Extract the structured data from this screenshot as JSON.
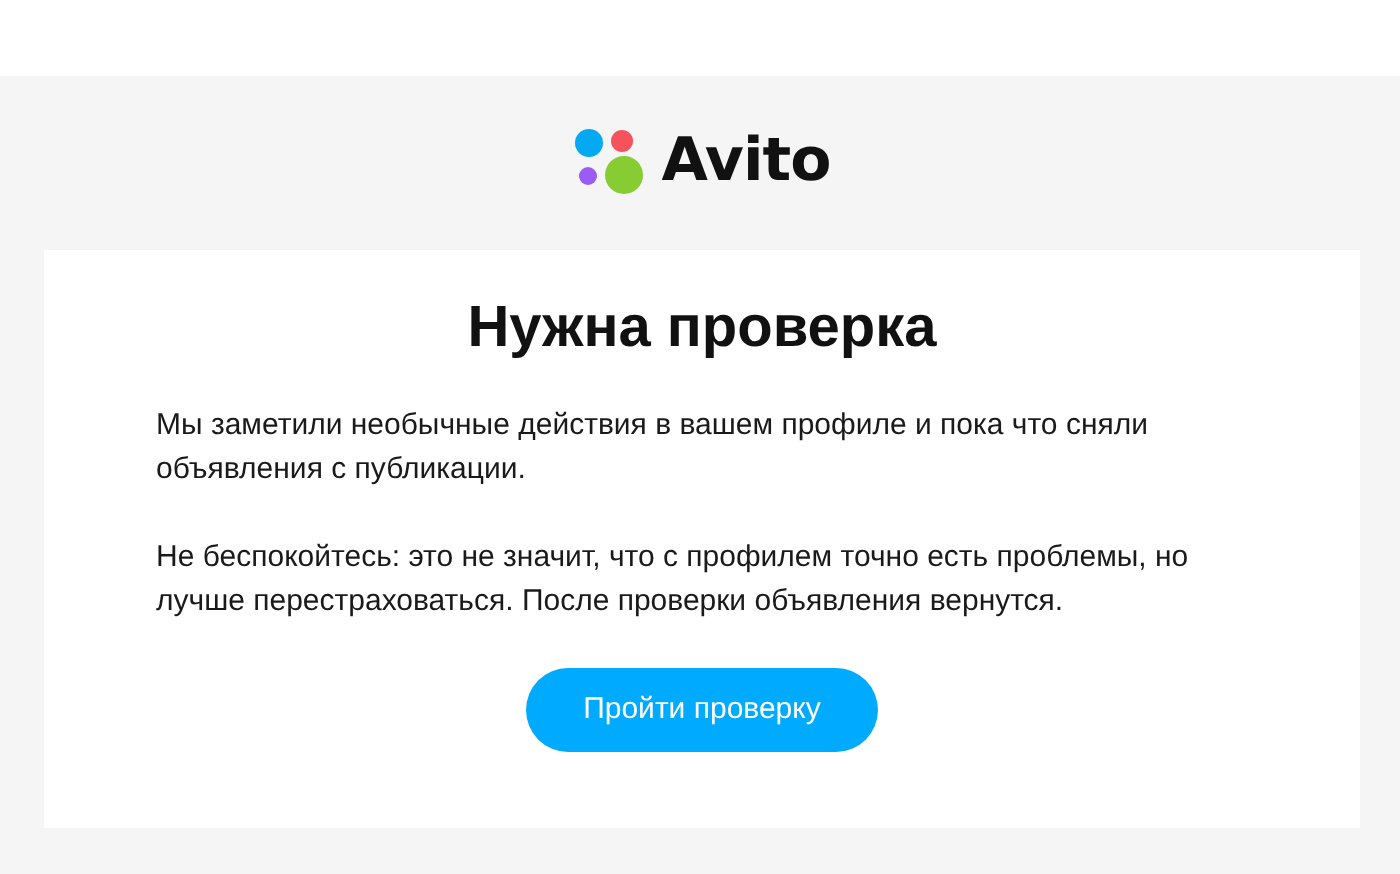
{
  "logo": {
    "text": "Avito"
  },
  "card": {
    "title": "Нужна проверка",
    "paragraphs": [
      "Мы заметили необычные действия в вашем профиле и пока что сняли объявления с публикации.",
      "Не беспокойтесь: это не значит, что с профилем точно есть проблемы, но лучше перестраховаться. После проверки объявления вернутся."
    ],
    "button": "Пройти проверку"
  }
}
